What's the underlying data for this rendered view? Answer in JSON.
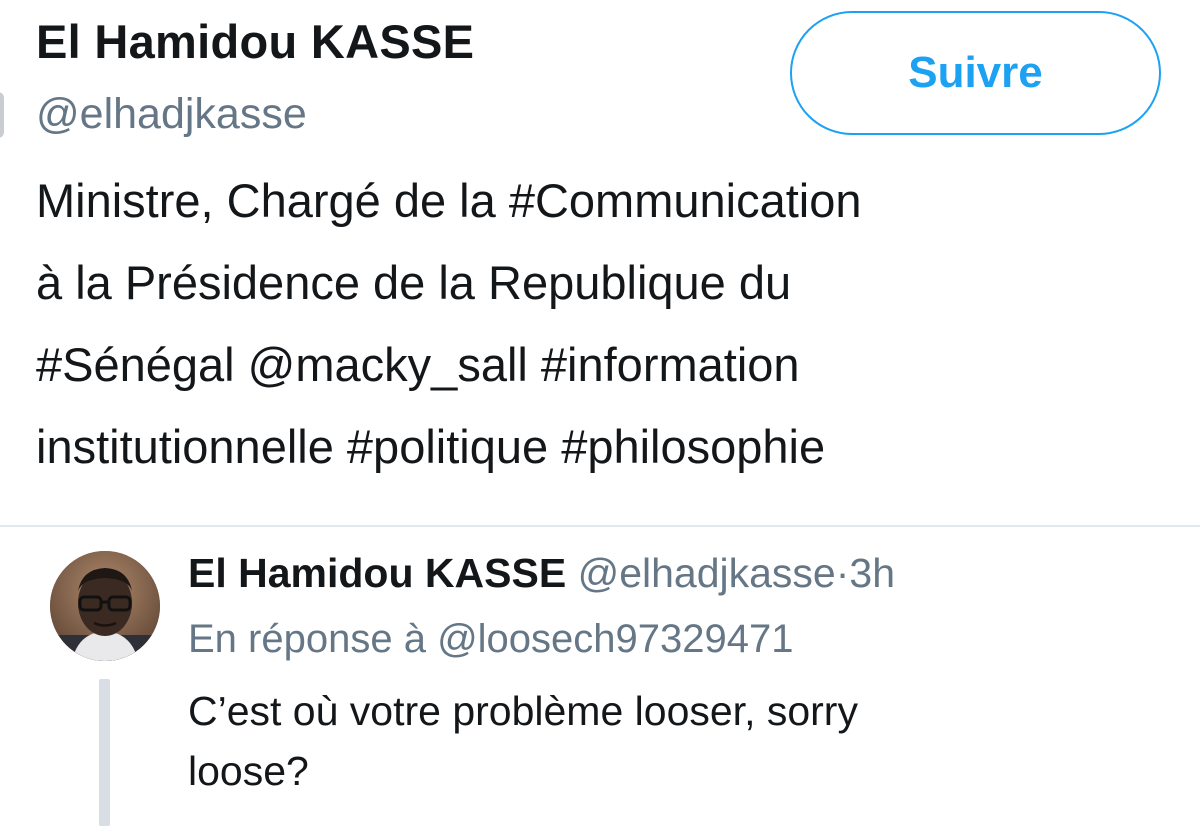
{
  "profile": {
    "display_name": "El Hamidou KASSE",
    "handle": "@elhadjkasse",
    "follow_label": "Suivre",
    "bio_lines": [
      "Ministre, Chargé de la #Communication",
      "à la Présidence de la Republique du",
      "#Sénégal @macky_sall #information",
      "institutionnelle #politique #philosophie"
    ]
  },
  "tweet": {
    "author_name": "El Hamidou KASSE",
    "author_handle": "@elhadjkasse",
    "separator": "·",
    "time": "3h",
    "reply_context": "En réponse à @loosech97329471",
    "text_lines": [
      "C’est où votre problème looser, sorry",
      "loose?"
    ]
  },
  "colors": {
    "accent": "#1da1f2",
    "text_primary": "#14171a",
    "text_secondary": "#657786",
    "divider": "#e1e8ed",
    "background": "#ffffff"
  },
  "icons": {
    "avatar": "avatar-photo"
  }
}
